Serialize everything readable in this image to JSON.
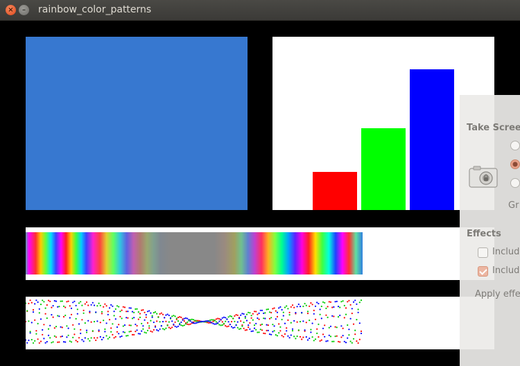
{
  "window": {
    "title": "rainbow_color_patterns",
    "close_glyph": "×",
    "minimize_glyph": "–"
  },
  "panels": {
    "solid_color": "#3778d0",
    "bars": [
      {
        "color": "#ff0000",
        "value": 0.22
      },
      {
        "color": "#00ff00",
        "value": 0.47
      },
      {
        "color": "#0000ff",
        "value": 0.81
      }
    ]
  },
  "screenshot_dialog": {
    "heading": "Take Scree",
    "grab_label": "Gr",
    "effects_heading": "Effects",
    "include_1": "Includ",
    "include_2": "Includ",
    "apply_label": "Apply effe",
    "icon": "camera-icon"
  }
}
